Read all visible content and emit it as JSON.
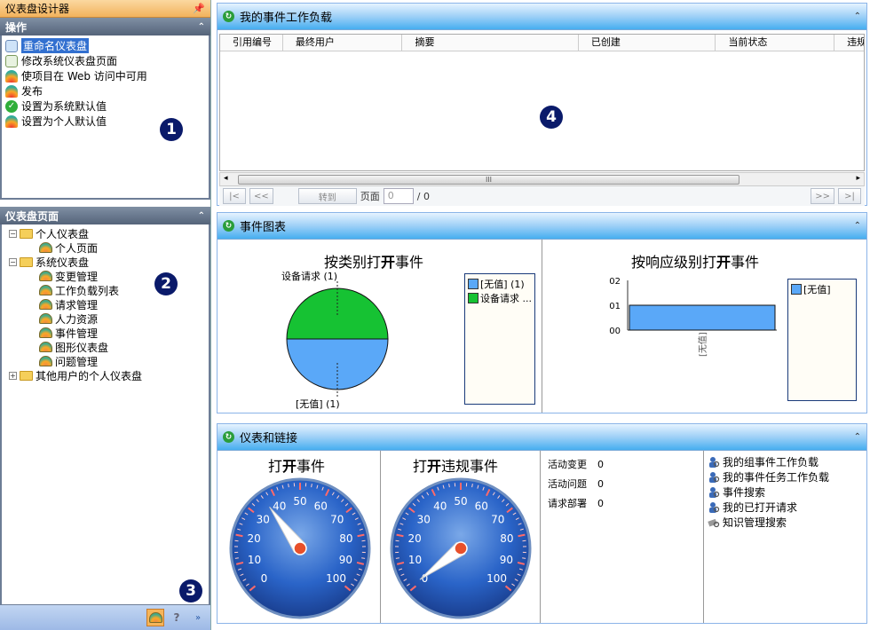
{
  "left": {
    "title": "仪表盘设计器",
    "pin_icon": "pin-icon",
    "ops_header": "操作",
    "ops": [
      {
        "label": "重命名仪表盘",
        "icon": "rename-icon",
        "selected": true
      },
      {
        "label": "修改系统仪表盘页面",
        "icon": "edit-page-icon"
      },
      {
        "label": "使项目在 Web 访问中可用",
        "icon": "web-gauge-icon"
      },
      {
        "label": "发布",
        "icon": "publish-gauge-icon"
      },
      {
        "label": "设置为系统默认值",
        "icon": "checkmark-icon"
      },
      {
        "label": "设置为个人默认值",
        "icon": "personal-default-icon"
      }
    ],
    "badge1": "1",
    "pages_header": "仪表盘页面",
    "tree": {
      "personal": "个人仪表盘",
      "personal_page": "个人页面",
      "system": "系统仪表盘",
      "system_children": [
        "变更管理",
        "工作负载列表",
        "请求管理",
        "人力资源",
        "事件管理",
        "图形仪表盘",
        "问题管理"
      ],
      "others": "其他用户的个人仪表盘"
    },
    "badge2": "2",
    "badge3": "3"
  },
  "workload": {
    "title": "我的事件工作负载",
    "columns": [
      "引用编号",
      "最终用户",
      "摘要",
      "已创建",
      "当前状态",
      "违规"
    ],
    "badge4": "4",
    "pager": {
      "first": "|<",
      "prev": "<<",
      "goto": "转到",
      "page_label": "页面",
      "page_value": "0",
      "of": "/ 0",
      "next": ">>",
      "last": ">|"
    },
    "scroll_thumb": "III"
  },
  "charts": {
    "title": "事件图表",
    "pie_legend": [
      "[无值] (1)",
      "设备请求 ..."
    ],
    "bar_legend": [
      "[无值]"
    ]
  },
  "chart_data": [
    {
      "type": "pie",
      "title_pre": "按类别打",
      "title_bold": "开",
      "title_post": "事件",
      "categories": [
        "设备请求",
        "[无值]"
      ],
      "values": [
        1,
        1
      ],
      "slice_labels": [
        "设备请求 (1)",
        "[无值] (1)"
      ],
      "colors": [
        "#16c233",
        "#5aa8f8"
      ]
    },
    {
      "type": "bar",
      "title_pre": "按响应级别打",
      "title_bold": "开",
      "title_post": "事件",
      "categories": [
        "[无值]"
      ],
      "values": [
        1
      ],
      "ytick_labels": [
        "02",
        "01",
        "00"
      ],
      "ylim": [
        0,
        2
      ],
      "colors": [
        "#5aa8f8"
      ]
    }
  ],
  "gauges": {
    "title": "仪表和链接",
    "gauge1_pre": "打",
    "gauge1_bold": "开",
    "gauge1_post": "事件",
    "gauge2_pre": "打",
    "gauge2_bold": "开",
    "gauge2_post": "违规事件",
    "gauge1_value": 36,
    "gauge2_value": 1,
    "ticks": [
      "0",
      "10",
      "20",
      "30",
      "40",
      "50",
      "60",
      "70",
      "80",
      "90",
      "100"
    ],
    "stats": [
      {
        "label": "活动变更",
        "value": "0"
      },
      {
        "label": "活动问题",
        "value": "0"
      },
      {
        "label": "请求部署",
        "value": "0"
      }
    ],
    "links": [
      {
        "label": "我的组事件工作负载",
        "icon": "person-search-icon"
      },
      {
        "label": "我的事件任务工作负载",
        "icon": "person-search-icon"
      },
      {
        "label": "事件搜索",
        "icon": "person-search-icon"
      },
      {
        "label": "我的已打开请求",
        "icon": "person-search-icon"
      },
      {
        "label": "知识管理搜索",
        "icon": "knowledge-search-icon"
      }
    ]
  },
  "colors": {
    "accent": "#46aef0",
    "dial": "#2a64c8",
    "needle": "#ffffff",
    "pie_green": "#16c233",
    "pie_blue": "#5aa8f8"
  }
}
